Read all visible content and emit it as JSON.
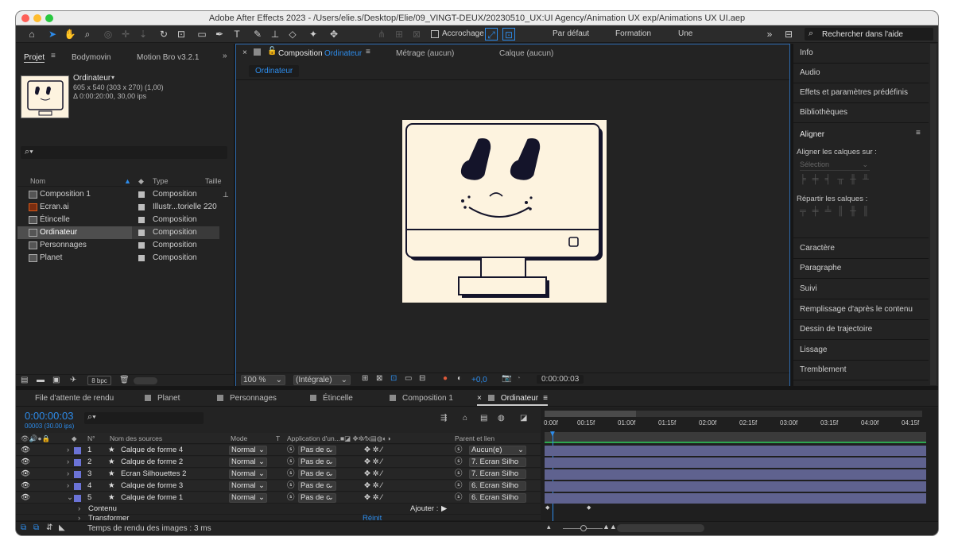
{
  "window": {
    "title": "Adobe After Effects 2023 - /Users/elie.s/Desktop/Elie/09_VINGT-DEUX/20230510_UX:UI Agency/Animation UX exp/Animations UX UI.aep"
  },
  "toolbar": {
    "snap_label": "Accrochage",
    "workspaces": [
      "Par défaut",
      "Formation",
      "Une"
    ],
    "search_placeholder": "Rechercher dans l'aide"
  },
  "project": {
    "tabs": [
      "Projet",
      "Bodymovin",
      "Motion Bro v3.2.1"
    ],
    "selected_name": "Ordinateur",
    "selected_info1": "605 x 540  (303 x 270) (1,00)",
    "selected_info2": "Δ 0:00:20:00, 30,00 ips",
    "col_name": "Nom",
    "col_type": "Type",
    "col_size": "Taille",
    "items": [
      {
        "name": "Composition 1",
        "type": "Composition",
        "size": ""
      },
      {
        "name": "Ecran.ai",
        "type": "Illustr...torielle",
        "size": "220"
      },
      {
        "name": "Étincelle",
        "type": "Composition",
        "size": ""
      },
      {
        "name": "Ordinateur",
        "type": "Composition",
        "size": ""
      },
      {
        "name": "Personnages",
        "type": "Composition",
        "size": ""
      },
      {
        "name": "Planet",
        "type": "Composition",
        "size": ""
      }
    ],
    "bpc": "8 bpc"
  },
  "viewer": {
    "tab_prefix": "Composition",
    "tab_name": "Ordinateur",
    "footage_tab": "Métrage  (aucun)",
    "layer_tab": "Calque  (aucun)",
    "breadcrumb": "Ordinateur",
    "zoom": "100 %",
    "resolution": "(Intégrale)",
    "exposure": "+0,0",
    "timecode": "0:00:00:03"
  },
  "right_panels": {
    "items": [
      "Info",
      "Audio",
      "Effets et paramètres prédéfinis",
      "Bibliothèques"
    ],
    "align_title": "Aligner",
    "align_to_label": "Aligner les calques sur :",
    "align_to_value": "Sélection",
    "distribute_label": "Répartir les calques :",
    "items2": [
      "Caractère",
      "Paragraphe",
      "Suivi",
      "Remplissage d'après le contenu",
      "Dessin de trajectoire",
      "Lissage",
      "Tremblement"
    ]
  },
  "timeline": {
    "tabs": [
      "File d'attente de rendu",
      "Planet",
      "Personnages",
      "Étincelle",
      "Composition 1",
      "Ordinateur"
    ],
    "timecode": "0:00:00:03",
    "frames": "00003 (30.00 ips)",
    "col_no": "N°",
    "col_source": "Nom des sources",
    "col_mode": "Mode",
    "col_t": "T",
    "col_app": "Application d'un...",
    "col_parent": "Parent et lien",
    "ruler": [
      "0:00f",
      "00:15f",
      "01:00f",
      "01:15f",
      "02:00f",
      "02:15f",
      "03:00f",
      "03:15f",
      "04:00f",
      "04:15f"
    ],
    "layers": [
      {
        "num": "1",
        "name": "Calque de forme 4",
        "mode": "Normal",
        "app": "Pas de c",
        "parent": "Aucun(e)"
      },
      {
        "num": "2",
        "name": "Calque de forme 2",
        "mode": "Normal",
        "app": "Pas de c",
        "parent": "7. Ecran Silho"
      },
      {
        "num": "3",
        "name": "Ecran Silhouettes 2",
        "mode": "Normal",
        "app": "Pas de c",
        "parent": "7. Ecran Silho"
      },
      {
        "num": "4",
        "name": "Calque de forme 3",
        "mode": "Normal",
        "app": "Pas de c",
        "parent": "6. Ecran Silho"
      },
      {
        "num": "5",
        "name": "Calque de forme 1",
        "mode": "Normal",
        "app": "Pas de c",
        "parent": "6. Ecran Silho"
      }
    ],
    "sub_content": "Contenu",
    "sub_transform": "Transformer",
    "add_label": "Ajouter :",
    "reset_label": "Réinit",
    "render_time": "Temps de rendu des images : 3 ms"
  },
  "colors": {
    "accent": "#2d8ceb",
    "layer_label": "#6b73d6",
    "bar": "#5f628f",
    "canvas": "#fdf3df",
    "ink": "#14142a"
  }
}
